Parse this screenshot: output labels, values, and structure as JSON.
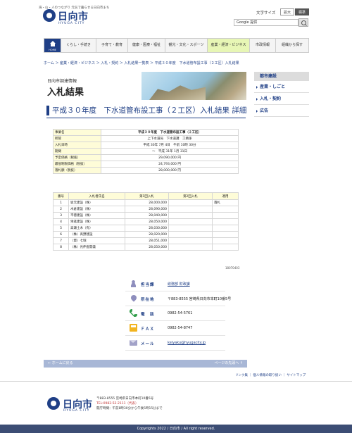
{
  "header": {
    "tagline": "海・山・人のつながり 元気で暮らせる日向市まち",
    "logo_text": "日向市",
    "logo_sub": "HYUGA CITY",
    "font_size_label": "文字サイズ",
    "font_size_large": "拡大",
    "font_size_standard": "標準",
    "search_placeholder": "Google 提供"
  },
  "gnav": {
    "home": "HOME",
    "items": [
      "くらし・手続き",
      "子育て・教育",
      "健康・医療・福祉",
      "観光・文化・スポーツ",
      "産業・経済・ビジネス",
      "市政情報",
      "組織から探す"
    ],
    "active_index": 4
  },
  "breadcrumb": "ホーム ＞ 産業・経済・ビジネス ＞ 入札・契約 ＞ 入札結果一覧表 ＞ 平成３０年度　下水道管布設工事（２工区）入札結果",
  "banner": {
    "subtitle": "日向市調達情報",
    "title": "入札結果"
  },
  "sidebar": {
    "items": [
      "都市建設",
      "産業・しごと",
      "入札・契約",
      "広告"
    ]
  },
  "page_title": "平成３０年度　下水道管布設工事（２工区）入札結果 詳細",
  "info_table": [
    {
      "key": "事業名",
      "value": "平成３０年度　下水道管布設工事（２工区）"
    },
    {
      "key": "所管",
      "value": "上下水道局　下水道課　工務係"
    },
    {
      "key": "入札日時",
      "value": "平成 30年 7月 4日　午前 10時 30分"
    },
    {
      "key": "期間",
      "value": "～　平成 31年 1月 31日"
    },
    {
      "key": "予定価格（税抜）",
      "value": "29,090,000 円"
    },
    {
      "key": "最低制限価格（税抜）",
      "value": "24,793,000 円"
    },
    {
      "key": "落札額（税抜）",
      "value": "28,000,000 円"
    }
  ],
  "bid_table": {
    "headers": [
      "番号",
      "入札者氏名",
      "第1回入札",
      "第2回入札",
      "適用"
    ],
    "rows": [
      {
        "no": "1",
        "name": "坂元建設（株）",
        "r1": "28,000,000",
        "r2": "",
        "note": "落札"
      },
      {
        "no": "2",
        "name": "木倉建設（株）",
        "r1": "28,090,000",
        "r2": "",
        "note": ""
      },
      {
        "no": "3",
        "name": "平徳建設（株）",
        "r1": "28,040,000",
        "r2": "",
        "note": ""
      },
      {
        "no": "4",
        "name": "栄進建設（株）",
        "r1": "28,050,000",
        "r2": "",
        "note": ""
      },
      {
        "no": "5",
        "name": "高瀬土木（有）",
        "r1": "28,030,000",
        "r2": "",
        "note": ""
      },
      {
        "no": "6",
        "name": "（株）高野建設",
        "r1": "28,020,000",
        "r2": "",
        "note": ""
      },
      {
        "no": "7",
        "name": "（資）七堀",
        "r1": "28,051,000",
        "r2": "",
        "note": ""
      },
      {
        "no": "8",
        "name": "（株）光伸産開発",
        "r1": "28,050,000",
        "r2": "",
        "note": ""
      }
    ]
  },
  "revision": "18070403",
  "contact": [
    {
      "label": "担当課",
      "value": "総務部 財政課",
      "link": true,
      "icon": "person-icon"
    },
    {
      "label": "所在地",
      "value": "〒883-8555 宮崎県日向市本町10番5号",
      "link": false,
      "icon": "pin-icon"
    },
    {
      "label": "電　話",
      "value": "0982-54-5761",
      "link": false,
      "icon": "phone-icon"
    },
    {
      "label": "ＦＡＸ",
      "value": "0982-54-8747",
      "link": false,
      "icon": "fax-icon"
    },
    {
      "label": "メール",
      "value": "keiyaku@hyugacity.jp",
      "link": true,
      "icon": "mail-icon"
    }
  ],
  "page_nav": {
    "home": "← ホームに戻る",
    "top": "ページの先頭へ ↑"
  },
  "footer_links": "リンク集 ｜ 個人情報の取り扱い ｜ サイトマップ",
  "footer": {
    "logo_text": "日向市",
    "logo_sub": "HYUGA CITY",
    "address": "〒883-8555 宮崎県日向市本町10番5号",
    "tel": "TEL:0982-52-2111（代表）",
    "hours": "開庁時間：午前8時30分から午後5時15分まで"
  },
  "copyright": "Copyrights 2022 / 日向市 / All right reserved."
}
